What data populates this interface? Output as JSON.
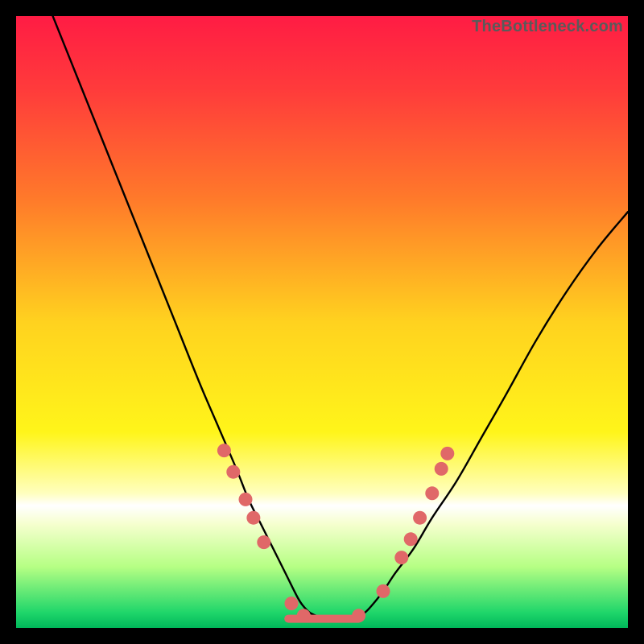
{
  "watermark": "TheBottleneck.com",
  "chart_data": {
    "type": "line",
    "title": "",
    "xlabel": "",
    "ylabel": "",
    "xlim": [
      0,
      100
    ],
    "ylim": [
      0,
      100
    ],
    "gradient_stops": [
      {
        "offset": 0.0,
        "color": "#ff1c44"
      },
      {
        "offset": 0.12,
        "color": "#ff3b3b"
      },
      {
        "offset": 0.3,
        "color": "#ff7a2a"
      },
      {
        "offset": 0.5,
        "color": "#ffd21f"
      },
      {
        "offset": 0.68,
        "color": "#fff51a"
      },
      {
        "offset": 0.78,
        "color": "#ffffbe"
      },
      {
        "offset": 0.8,
        "color": "#ffffff"
      },
      {
        "offset": 0.83,
        "color": "#f6ffcf"
      },
      {
        "offset": 0.9,
        "color": "#b6ff84"
      },
      {
        "offset": 0.975,
        "color": "#1fd66a"
      },
      {
        "offset": 1.0,
        "color": "#00b85a"
      }
    ],
    "series": [
      {
        "name": "left-curve",
        "color": "#000000",
        "x": [
          6,
          10,
          14,
          18,
          22,
          26,
          30,
          33,
          36,
          38,
          40,
          42,
          44,
          46,
          47,
          48,
          49
        ],
        "y": [
          100,
          90,
          80,
          70,
          60,
          50,
          40,
          33,
          26,
          21,
          17,
          13,
          9,
          5,
          3.5,
          2.5,
          2
        ]
      },
      {
        "name": "right-curve",
        "color": "#000000",
        "x": [
          56,
          57,
          58,
          60,
          62,
          65,
          68,
          72,
          76,
          80,
          85,
          90,
          95,
          100
        ],
        "y": [
          2,
          2.5,
          3.5,
          6,
          9,
          13,
          18,
          24,
          31,
          38,
          47,
          55,
          62,
          68
        ]
      },
      {
        "name": "flat-bottom",
        "color": "#e06868",
        "x": [
          44.5,
          56
        ],
        "y": [
          1.5,
          1.5
        ]
      }
    ],
    "scatter": [
      {
        "series": "left-dots",
        "color": "#e06868",
        "points": [
          {
            "x": 34.0,
            "y": 29.0
          },
          {
            "x": 35.5,
            "y": 25.5
          },
          {
            "x": 37.5,
            "y": 21.0
          },
          {
            "x": 38.8,
            "y": 18.0
          },
          {
            "x": 40.5,
            "y": 14.0
          },
          {
            "x": 45.0,
            "y": 4.0
          },
          {
            "x": 47.0,
            "y": 2.0
          }
        ]
      },
      {
        "series": "right-dots",
        "color": "#e06868",
        "points": [
          {
            "x": 56.0,
            "y": 2.0
          },
          {
            "x": 60.0,
            "y": 6.0
          },
          {
            "x": 63.0,
            "y": 11.5
          },
          {
            "x": 64.5,
            "y": 14.5
          },
          {
            "x": 66.0,
            "y": 18.0
          },
          {
            "x": 68.0,
            "y": 22.0
          },
          {
            "x": 69.5,
            "y": 26.0
          },
          {
            "x": 70.5,
            "y": 28.5
          }
        ]
      }
    ]
  }
}
